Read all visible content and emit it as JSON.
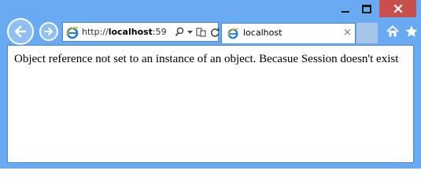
{
  "window": {
    "caption": {
      "minimize_icon": "minimize-icon",
      "maximize_icon": "maximize-icon",
      "close_icon": "close-icon",
      "close_color": "#c7504c"
    },
    "frame_color": "#6aaaf2"
  },
  "nav": {
    "back_icon": "back-arrow-icon",
    "forward_icon": "forward-arrow-icon"
  },
  "address_bar": {
    "prefix": "http://",
    "host": "localhost",
    "suffix": ":59",
    "site_icon": "ie-logo-icon",
    "tools": [
      "search-icon",
      "dropdown-icon",
      "compatibility-icon",
      "refresh-icon"
    ]
  },
  "tab": {
    "title": "localhost",
    "close_label": "×",
    "icon": "ie-logo-icon"
  },
  "toolbar": {
    "home_icon": "home-icon",
    "favorites_icon": "star-icon"
  },
  "page": {
    "message": "Object reference not set to an instance of an object. Becasue Session doesn't exist"
  }
}
